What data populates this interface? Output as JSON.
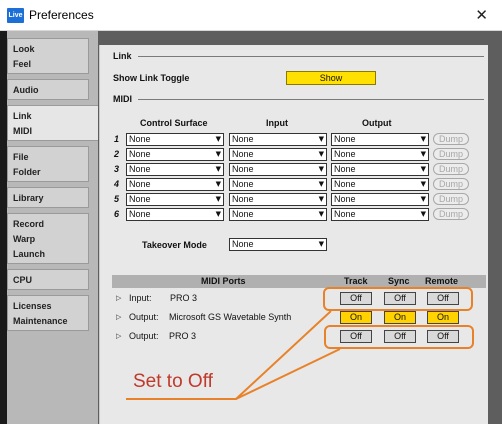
{
  "window": {
    "title": "Preferences",
    "app_icon_text": "Live"
  },
  "sidebar": {
    "items": [
      {
        "lines": [
          "Look",
          "Feel"
        ]
      },
      {
        "lines": [
          "Audio"
        ]
      },
      {
        "lines": [
          "Link",
          "MIDI"
        ]
      },
      {
        "lines": [
          "File",
          "Folder"
        ]
      },
      {
        "lines": [
          "Library"
        ]
      },
      {
        "lines": [
          "Record",
          "Warp",
          "Launch"
        ]
      },
      {
        "lines": [
          "CPU"
        ]
      },
      {
        "lines": [
          "Licenses",
          "Maintenance"
        ]
      }
    ],
    "active_index": 2
  },
  "link": {
    "section_title": "Link",
    "toggle_label": "Show Link Toggle",
    "toggle_value": "Show"
  },
  "midi": {
    "section_title": "MIDI",
    "headers": {
      "control_surface": "Control Surface",
      "input": "Input",
      "output": "Output"
    },
    "rows": [
      {
        "num": "1",
        "control_surface": "None",
        "input": "None",
        "output": "None",
        "dump": "Dump"
      },
      {
        "num": "2",
        "control_surface": "None",
        "input": "None",
        "output": "None",
        "dump": "Dump"
      },
      {
        "num": "3",
        "control_surface": "None",
        "input": "None",
        "output": "None",
        "dump": "Dump"
      },
      {
        "num": "4",
        "control_surface": "None",
        "input": "None",
        "output": "None",
        "dump": "Dump"
      },
      {
        "num": "5",
        "control_surface": "None",
        "input": "None",
        "output": "None",
        "dump": "Dump"
      },
      {
        "num": "6",
        "control_surface": "None",
        "input": "None",
        "output": "None",
        "dump": "Dump"
      }
    ],
    "takeover_label": "Takeover Mode",
    "takeover_value": "None"
  },
  "ports": {
    "headers": {
      "ports": "MIDI Ports",
      "track": "Track",
      "sync": "Sync",
      "remote": "Remote"
    },
    "rows": [
      {
        "label": "Input:",
        "name": "PRO 3",
        "track": "Off",
        "sync": "Off",
        "remote": "Off"
      },
      {
        "label": "Output:",
        "name": "Microsoft GS Wavetable Synth",
        "track": "On",
        "sync": "On",
        "remote": "On"
      },
      {
        "label": "Output:",
        "name": "PRO 3",
        "track": "Off",
        "sync": "Off",
        "remote": "Off"
      }
    ]
  },
  "annotation": {
    "text": "Set to Off",
    "color": "#e8822a",
    "text_color": "#c0392b"
  },
  "colors": {
    "yellow": "#ffe000",
    "on": "#ffd200",
    "panel": "#e8e8e8",
    "sidebar": "#b8b8b8"
  }
}
